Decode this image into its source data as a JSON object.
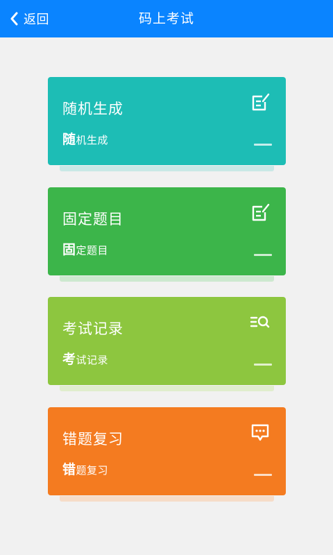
{
  "header": {
    "back_label": "返回",
    "title": "码上考试",
    "bg_color": "#0a84ff"
  },
  "cards": [
    {
      "title": "随机生成",
      "sub_first": "随",
      "sub_rest": "机生成",
      "icon": "edit-note-icon",
      "color": "#1dbdb5",
      "shadow_color": "#c9e8e6"
    },
    {
      "title": "固定题目",
      "sub_first": "固",
      "sub_rest": "定题目",
      "icon": "edit-note-icon",
      "color": "#3cb54a",
      "shadow_color": "#cde8cf"
    },
    {
      "title": "考试记录",
      "sub_first": "考",
      "sub_rest": "试记录",
      "icon": "list-search-icon",
      "color": "#8dc63f",
      "shadow_color": "#e0edcd"
    },
    {
      "title": "错题复习",
      "sub_first": "错",
      "sub_rest": "题复习",
      "icon": "chat-bubble-icon",
      "color": "#f47b20",
      "shadow_color": "#f6dcc8"
    }
  ]
}
